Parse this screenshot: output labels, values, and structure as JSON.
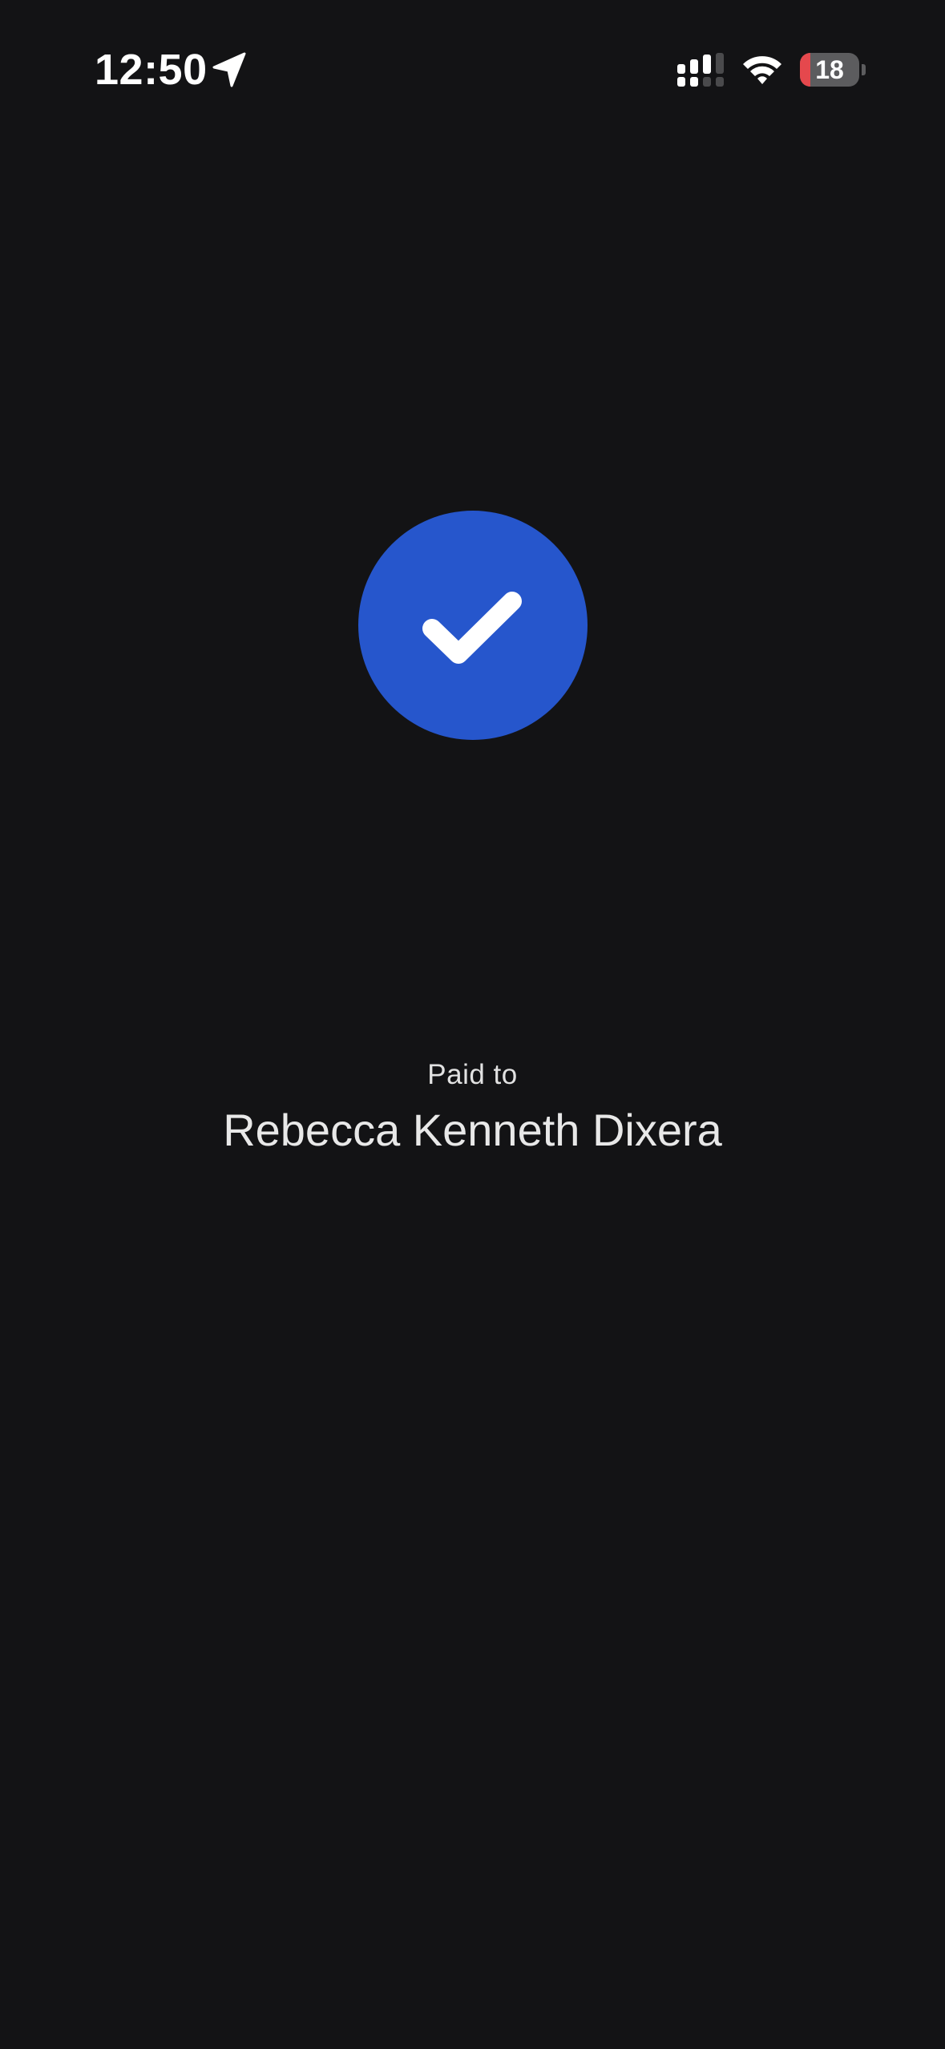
{
  "status_bar": {
    "time": "12:50",
    "location_icon": "location-arrow-icon",
    "signal_icon": "cellular-signal-icon",
    "wifi_icon": "wifi-icon",
    "battery_icon": "battery-icon",
    "battery_level": "18",
    "battery_fraction": 0.18,
    "battery_low_color": "#e5484d"
  },
  "success": {
    "icon": "checkmark-icon",
    "badge_color": "#2656cc"
  },
  "payment": {
    "label": "Paid to",
    "payee_name": "Rebecca Kenneth Dixera"
  },
  "theme": {
    "background": "#131315",
    "text": "#e6e6e6"
  }
}
